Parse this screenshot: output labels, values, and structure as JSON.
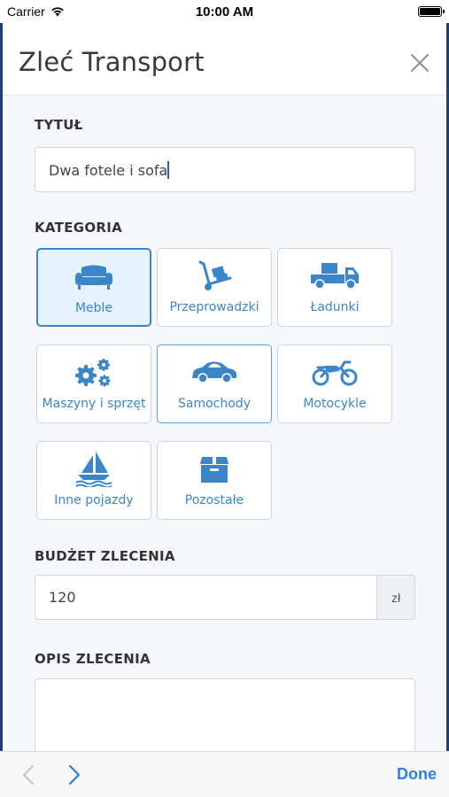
{
  "status_bar": {
    "carrier": "Carrier",
    "time": "10:00 AM"
  },
  "header": {
    "title": "Zleć Transport"
  },
  "title_section": {
    "label": "TYTUŁ",
    "value": "Dwa fotele i sofa"
  },
  "category_section": {
    "label": "KATEGORIA",
    "tiles": [
      {
        "label": "Meble",
        "icon": "sofa-icon",
        "state": "selected"
      },
      {
        "label": "Przeprowadzki",
        "icon": "hand-truck-icon",
        "state": "normal"
      },
      {
        "label": "Ładunki",
        "icon": "truck-icon",
        "state": "normal"
      },
      {
        "label": "Maszyny i sprzęt",
        "icon": "gears-icon",
        "state": "normal"
      },
      {
        "label": "Samochody",
        "icon": "car-icon",
        "state": "hover"
      },
      {
        "label": "Motocykle",
        "icon": "motorcycle-icon",
        "state": "normal"
      },
      {
        "label": "Inne pojazdy",
        "icon": "sailboat-icon",
        "state": "normal"
      },
      {
        "label": "Pozostałe",
        "icon": "box-icon",
        "state": "normal"
      }
    ]
  },
  "budget_section": {
    "label": "BUDŻET ZLECENIA",
    "value": "120",
    "currency": "zł"
  },
  "description_section": {
    "label": "OPIS ZLECENIA",
    "value": ""
  },
  "keyboard_toolbar": {
    "done_label": "Done"
  },
  "colors": {
    "accent": "#3a86c8",
    "selected_bg": "#e6f3fd",
    "done": "#2f7fdc",
    "backdrop": "#1f3f6e"
  }
}
